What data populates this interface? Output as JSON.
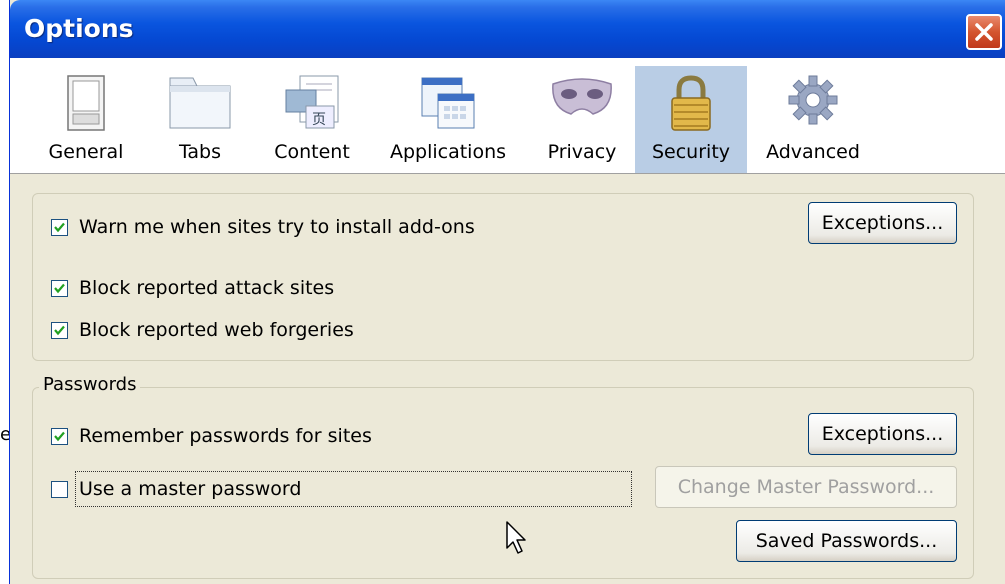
{
  "window": {
    "title": "Options"
  },
  "toolbar": {
    "items": [
      {
        "label": "General",
        "icon": "general-icon",
        "selected": false
      },
      {
        "label": "Tabs",
        "icon": "tabs-icon",
        "selected": false
      },
      {
        "label": "Content",
        "icon": "content-icon",
        "selected": false
      },
      {
        "label": "Applications",
        "icon": "applications-icon",
        "selected": false
      },
      {
        "label": "Privacy",
        "icon": "privacy-mask-icon",
        "selected": false
      },
      {
        "label": "Security",
        "icon": "padlock-icon",
        "selected": true
      },
      {
        "label": "Advanced",
        "icon": "gear-icon",
        "selected": false
      }
    ]
  },
  "security": {
    "warn_addons": {
      "label": "Warn me when sites try to install add-ons",
      "checked": true
    },
    "exceptions_label": "Exceptions...",
    "block_attack": {
      "label": "Block reported attack sites",
      "checked": true
    },
    "block_forgeries": {
      "label": "Block reported web forgeries",
      "checked": true
    }
  },
  "passwords": {
    "legend": "Passwords",
    "remember": {
      "label": "Remember passwords for sites",
      "checked": true
    },
    "exceptions_label": "Exceptions...",
    "master": {
      "label": "Use a master password",
      "checked": false
    },
    "change_master_label": "Change Master Password...",
    "saved_label": "Saved Passwords..."
  },
  "stray_text": "e",
  "colors": {
    "titlebar": "#0a55df",
    "selected_tab": "#b9cde5",
    "dialog_bg": "#ece9d8",
    "close_button": "#d4552f"
  }
}
